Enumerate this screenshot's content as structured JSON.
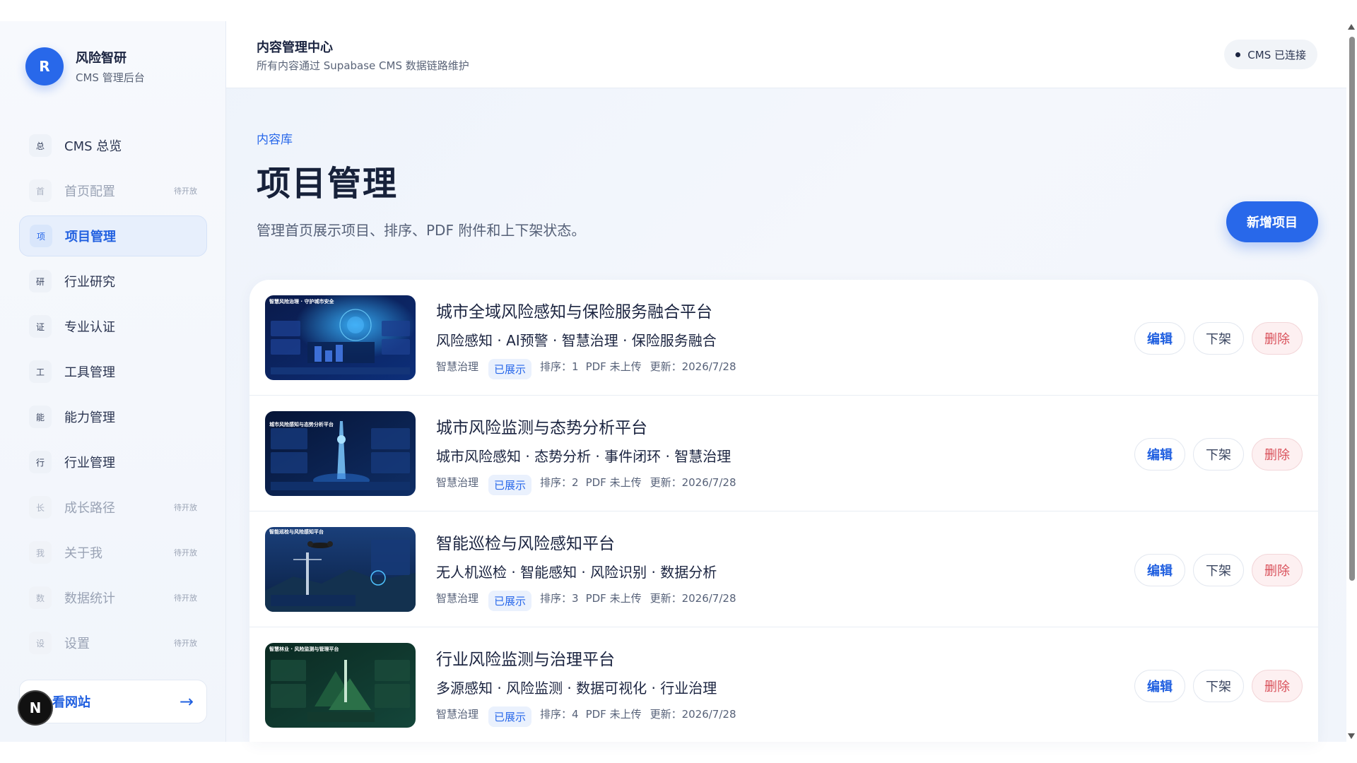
{
  "brand": {
    "logo_letter": "R",
    "name": "风险智研",
    "subtitle": "CMS 管理后台"
  },
  "sidebar": {
    "items": [
      {
        "badge": "总",
        "label": "CMS 总览",
        "pending": "",
        "state": "normal"
      },
      {
        "badge": "首",
        "label": "首页配置",
        "pending": "待开放",
        "state": "disabled"
      },
      {
        "badge": "项",
        "label": "项目管理",
        "pending": "",
        "state": "active"
      },
      {
        "badge": "研",
        "label": "行业研究",
        "pending": "",
        "state": "normal"
      },
      {
        "badge": "证",
        "label": "专业认证",
        "pending": "",
        "state": "normal"
      },
      {
        "badge": "工",
        "label": "工具管理",
        "pending": "",
        "state": "normal"
      },
      {
        "badge": "能",
        "label": "能力管理",
        "pending": "",
        "state": "normal"
      },
      {
        "badge": "行",
        "label": "行业管理",
        "pending": "",
        "state": "normal"
      },
      {
        "badge": "长",
        "label": "成长路径",
        "pending": "待开放",
        "state": "disabled"
      },
      {
        "badge": "我",
        "label": "关于我",
        "pending": "待开放",
        "state": "disabled"
      },
      {
        "badge": "数",
        "label": "数据统计",
        "pending": "待开放",
        "state": "disabled"
      },
      {
        "badge": "设",
        "label": "设置",
        "pending": "待开放",
        "state": "disabled"
      }
    ],
    "site_link_label": "看网站",
    "site_link_arrow": "→",
    "overlay_badge": "N"
  },
  "topbar": {
    "title": "内容管理中心",
    "subtitle": "所有内容通过 Supabase CMS 数据链路维护",
    "status": "CMS 已连接"
  },
  "page": {
    "eyebrow": "内容库",
    "title": "项目管理",
    "description": "管理首页展示项目、排序、PDF 附件和上下架状态。",
    "add_button": "新增项目"
  },
  "projects": [
    {
      "title": "城市全域风险感知与保险服务融合平台",
      "tags": "风险感知 · AI预警 · 智慧治理 · 保险服务融合",
      "category": "智慧治理",
      "state": "已展示",
      "order": "排序：1",
      "pdf": "PDF 未上传",
      "updated": "更新：2026/7/28",
      "thumb_caption": "智慧风险治理 · 守护城市安全",
      "thumb_theme": "blue-city"
    },
    {
      "title": "城市风险监测与态势分析平台",
      "tags": "城市风险感知 · 态势分析 · 事件闭环 · 智慧治理",
      "category": "智慧治理",
      "state": "已展示",
      "order": "排序：2",
      "pdf": "PDF 未上传",
      "updated": "更新：2026/7/28",
      "thumb_caption": "城市风险感知与态势分析平台",
      "thumb_theme": "blue-tower"
    },
    {
      "title": "智能巡检与风险感知平台",
      "tags": "无人机巡检 · 智能感知 · 风险识别 · 数据分析",
      "category": "智慧治理",
      "state": "已展示",
      "order": "排序：3",
      "pdf": "PDF 未上传",
      "updated": "更新：2026/7/28",
      "thumb_caption": "智能巡检与风险感知平台",
      "thumb_theme": "blue-drone"
    },
    {
      "title": "行业风险监测与治理平台",
      "tags": "多源感知 · 风险监测 · 数据可视化 · 行业治理",
      "category": "智慧治理",
      "state": "已展示",
      "order": "排序：4",
      "pdf": "PDF 未上传",
      "updated": "更新：2026/7/28",
      "thumb_caption": "智慧林业 · 风险监测与管理平台",
      "thumb_theme": "green-forest"
    }
  ],
  "actions": {
    "edit": "编辑",
    "offline": "下架",
    "delete": "删除"
  },
  "colors": {
    "accent": "#2868ea",
    "danger": "#d9505a",
    "sidebar_bg": "#f4f7fc"
  }
}
